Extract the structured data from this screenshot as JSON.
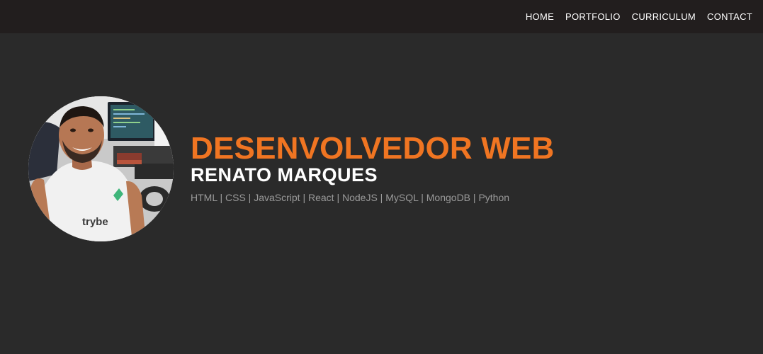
{
  "nav": {
    "items": [
      {
        "label": "HOME"
      },
      {
        "label": "PORTFOLIO"
      },
      {
        "label": "CURRICULUM"
      },
      {
        "label": "CONTACT"
      }
    ]
  },
  "hero": {
    "title": "DESENVOLVEDOR WEB",
    "name": "RENATO MARQUES",
    "skills": "HTML | CSS | JavaScript | React | NodeJS | MySQL | MongoDB | Python",
    "avatar_shirt_text": "trybe"
  },
  "colors": {
    "accent": "#f07522",
    "topbar": "#221e1e",
    "background": "#2a2a2a",
    "skills_text": "#9a9a9a"
  }
}
